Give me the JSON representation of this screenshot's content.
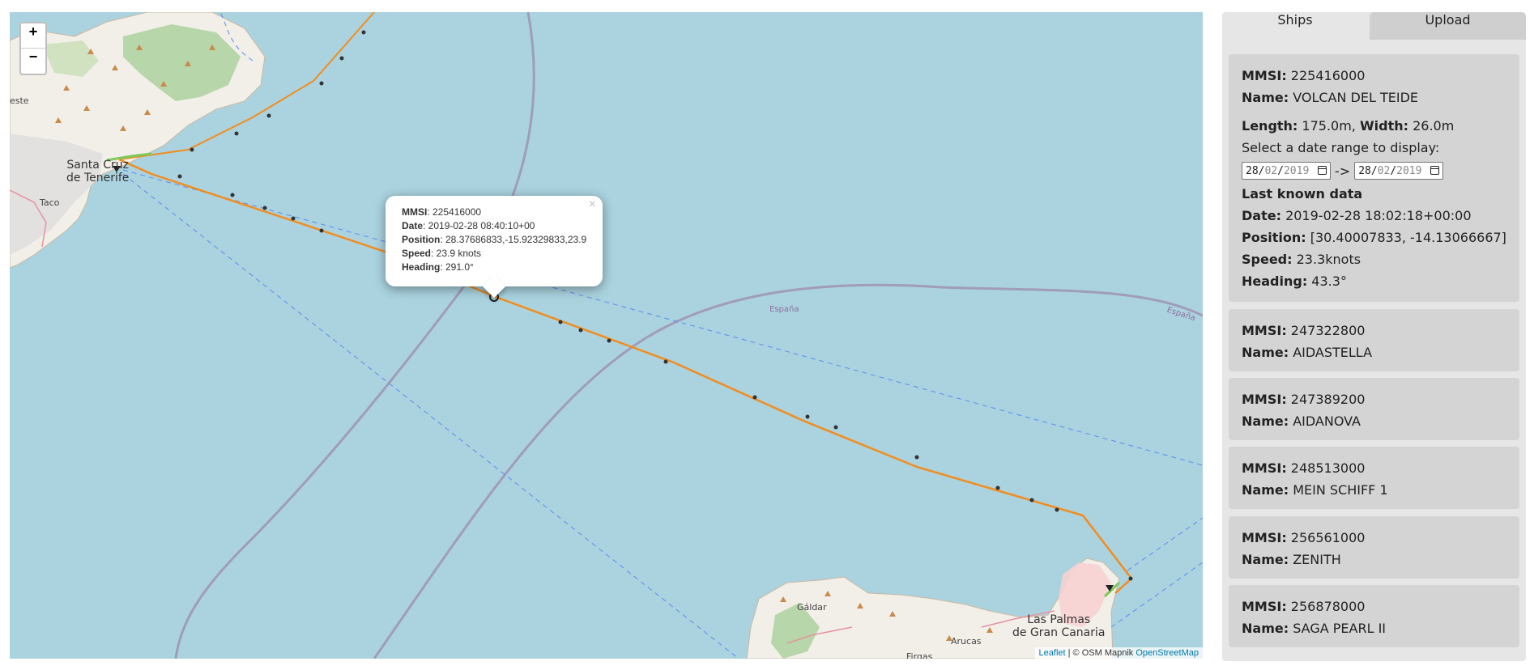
{
  "map": {
    "zoom_in": "+",
    "zoom_out": "−",
    "popup": {
      "close": "×",
      "mmsi_label": "MMSI",
      "mmsi": ": 225416000",
      "date_label": "Date",
      "date": ": 2019-02-28 08:40:10+00",
      "position_label": "Position",
      "position": ": 28.37686833,-15.92329833,23.9",
      "speed_label": "Speed",
      "speed": ": 23.9 knots",
      "heading_label": "Heading",
      "heading": ": 291.0°"
    },
    "attribution": {
      "leaflet": "Leaflet",
      "osm": " | © OSM Mapnik ",
      "osm_link": "OpenStreetMap"
    },
    "labels": {
      "santa_cruz_1": "Santa Cruz",
      "santa_cruz_2": "de Tenerife",
      "las_palmas_1": "Las Palmas",
      "las_palmas_2": "de Gran Canaria",
      "galdar": "Gáldar",
      "arucas": "Arucas",
      "firgas": "Firgas",
      "taco": "Taco",
      "este": "este",
      "espana_1": "España",
      "espana_2": "España"
    },
    "colors": {
      "sea": "#aad3df",
      "land": "#f2efe9",
      "forest": "#add19e",
      "track": "#f28c1e",
      "border": "#9e8fb0",
      "ferry": "#5b8bf0"
    }
  },
  "sidebar": {
    "tabs": [
      "Ships",
      "Upload"
    ],
    "selected": {
      "mmsi_label": "MMSI:",
      "mmsi": " 225416000",
      "name_label": "Name:",
      "name": " VOLCAN DEL TEIDE",
      "length_label": "Length:",
      "length": " 175.0m,",
      "width_label": "Width:",
      "width": " 26.0m",
      "range_prompt": "Select a date range to display:",
      "date_from": {
        "dd": "28",
        "mm": "02",
        "yyyy": "2019"
      },
      "range_arrow": "->",
      "date_to": {
        "dd": "28",
        "mm": "02",
        "yyyy": "2019"
      },
      "last_known_title": "Last known data",
      "date_label": "Date:",
      "date": " 2019-02-28 18:02:18+00:00",
      "position_label": "Position:",
      "position": " [30.40007833, -14.13066667]",
      "speed_label": "Speed:",
      "speed": " 23.3knots",
      "heading_label": "Heading:",
      "heading": " 43.3°"
    },
    "ships": [
      {
        "mmsi": " 247322800",
        "name": " AIDASTELLA"
      },
      {
        "mmsi": " 247389200",
        "name": " AIDANOVA"
      },
      {
        "mmsi": " 248513000",
        "name": " MEIN SCHIFF 1"
      },
      {
        "mmsi": " 256561000",
        "name": " ZENITH"
      },
      {
        "mmsi": " 256878000",
        "name": " SAGA PEARL II"
      }
    ],
    "mmsi_label": "MMSI:",
    "name_label": "Name:"
  }
}
